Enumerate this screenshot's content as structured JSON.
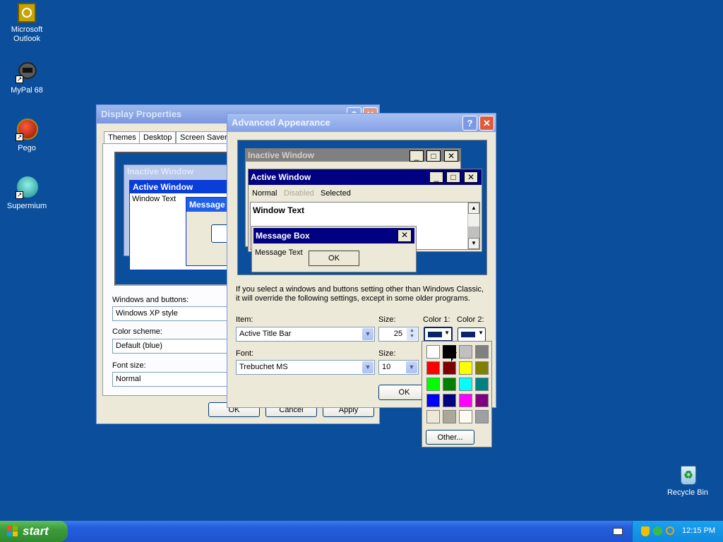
{
  "desktop": {
    "icons": [
      {
        "label": "Microsoft Outlook"
      },
      {
        "label": "MyPal 68"
      },
      {
        "label": "Pego"
      },
      {
        "label": "Supermium"
      },
      {
        "label": "Recycle Bin"
      }
    ]
  },
  "display_properties": {
    "title": "Display Properties",
    "tabs": [
      "Themes",
      "Desktop",
      "Screen Saver"
    ],
    "preview": {
      "inactive": "Inactive Window",
      "active": "Active Window",
      "window_text": "Window Text",
      "message": "Message"
    },
    "windows_buttons_label": "Windows and buttons:",
    "windows_buttons_value": "Windows XP style",
    "color_scheme_label": "Color scheme:",
    "color_scheme_value": "Default (blue)",
    "font_size_label": "Font size:",
    "font_size_value": "Normal",
    "ok": "OK",
    "cancel": "Cancel",
    "apply": "Apply"
  },
  "advanced_appearance": {
    "title": "Advanced Appearance",
    "help_glyph": "?",
    "close_glyph": "✕",
    "preview": {
      "inactive_title": "Inactive Window",
      "active_title": "Active Window",
      "menu_normal": "Normal",
      "menu_disabled": "Disabled",
      "menu_selected": "Selected",
      "window_text": "Window Text",
      "msgbox_title": "Message Box",
      "msgbox_text": "Message Text",
      "msgbox_ok": "OK"
    },
    "info_line1": "If you select a windows and buttons setting other than Windows Classic,",
    "info_line2": "it will override the following settings, except in some older programs.",
    "item_label": "Item:",
    "item_value": "Active Title Bar",
    "size_label": "Size:",
    "size_value": "25",
    "color1_label": "Color 1:",
    "color2_label": "Color 2:",
    "font_label": "Font:",
    "font_value": "Trebuchet MS",
    "font_size_label": "Size:",
    "font_size_value": "10",
    "ok": "OK"
  },
  "color_picker": {
    "swatches": [
      "#ffffff",
      "#000000",
      "#c0c0c0",
      "#808080",
      "#ff0000",
      "#800000",
      "#ffff00",
      "#808000",
      "#00ff00",
      "#008000",
      "#00ffff",
      "#008080",
      "#0000ff",
      "#000080",
      "#ff00ff",
      "#800080",
      "#ece9d8",
      "#aca899",
      "#fffbf0",
      "#a0a0a4"
    ],
    "other_label": "Other..."
  },
  "taskbar": {
    "start_label": "start",
    "clock": "12:15 PM"
  },
  "colors": {
    "desktop": "#0b4f9c",
    "accent_navy": "#0a246a",
    "taskbar": "#245edb",
    "start_green": "#3c9b3c"
  }
}
